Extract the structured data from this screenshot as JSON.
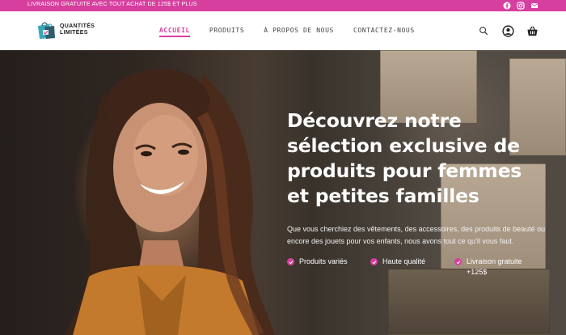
{
  "topbar": {
    "promo": "LIVRAISON GRATUITE AVEC TOUT ACHAT DE 125$ ET PLUS",
    "social": [
      "facebook-icon",
      "instagram-icon",
      "mail-icon"
    ]
  },
  "header": {
    "logo": {
      "line1": "QUANTITÉS",
      "line2": "LIMITÉES"
    },
    "nav": [
      {
        "label": "ACCUEIL",
        "active": true
      },
      {
        "label": "PRODUITS",
        "active": false
      },
      {
        "label": "À PROPOS DE NOUS",
        "active": false
      },
      {
        "label": "CONTACTEZ-NOUS",
        "active": false
      }
    ],
    "icons": [
      "search-icon",
      "account-icon",
      "cart-icon"
    ]
  },
  "hero": {
    "title": "Découvrez notre sélection exclusive de produits pour femmes et petites familles",
    "subtitle": "Que vous cherchiez des vêtements, des accessoires, des produits de beauté ou encore des jouets pour vos enfants, nous avons tout ce qu'il vous faut.",
    "features": [
      {
        "label": "Produits variés"
      },
      {
        "label": "Haute qualité"
      },
      {
        "label": "Livraison gratuite +125$"
      }
    ]
  },
  "colors": {
    "accent": "#d63f9e",
    "text_dark": "#222222",
    "white": "#ffffff"
  }
}
